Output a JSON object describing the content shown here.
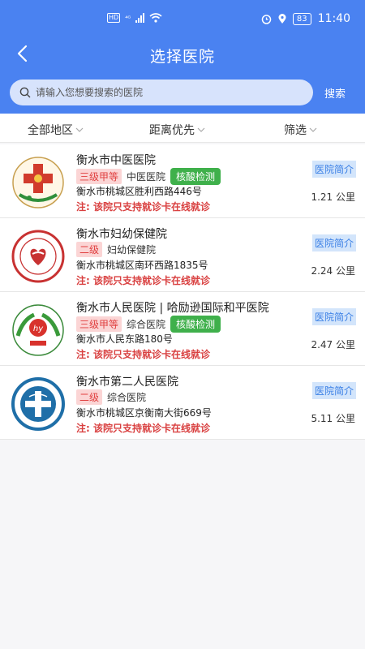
{
  "status": {
    "net": "⁴ᴳ",
    "battery": "83",
    "time": "11:40"
  },
  "header": {
    "title": "选择医院"
  },
  "search": {
    "placeholder": "请输入您想要搜索的医院",
    "button_label": "搜索"
  },
  "filters": [
    "全部地区",
    "距离优先",
    "筛选"
  ],
  "hospitals": [
    {
      "name": "衡水市中医医院",
      "level": "三级甲等",
      "type": "中医医院",
      "nat": "核酸检测",
      "address": "衡水市桃城区胜利西路446号",
      "note": "注:  该院只支持就诊卡在线就诊",
      "intro": "医院简介",
      "distance": "1.21 公里"
    },
    {
      "name": "衡水市妇幼保健院",
      "level": "二级",
      "type": "妇幼保健院",
      "nat": "",
      "address": "衡水市桃城区南环西路1835号",
      "note": "注:  该院只支持就诊卡在线就诊",
      "intro": "医院简介",
      "distance": "2.24 公里"
    },
    {
      "name": "衡水市人民医院 | 哈励逊国际和平医院",
      "level": "三级甲等",
      "type": "综合医院",
      "nat": "核酸检测",
      "address": "衡水市人民东路180号",
      "note": "注:  该院只支持就诊卡在线就诊",
      "intro": "医院简介",
      "distance": "2.47 公里"
    },
    {
      "name": "衡水市第二人民医院",
      "level": "二级",
      "type": "综合医院",
      "nat": "",
      "address": "衡水市桃城区京衡南大街669号",
      "note": "注:  该院只支持就诊卡在线就诊",
      "intro": "医院简介",
      "distance": "5.11 公里"
    }
  ],
  "colors": {
    "primary": "#4a82f1",
    "warning": "#d94040",
    "nat": "#3fb04b"
  }
}
